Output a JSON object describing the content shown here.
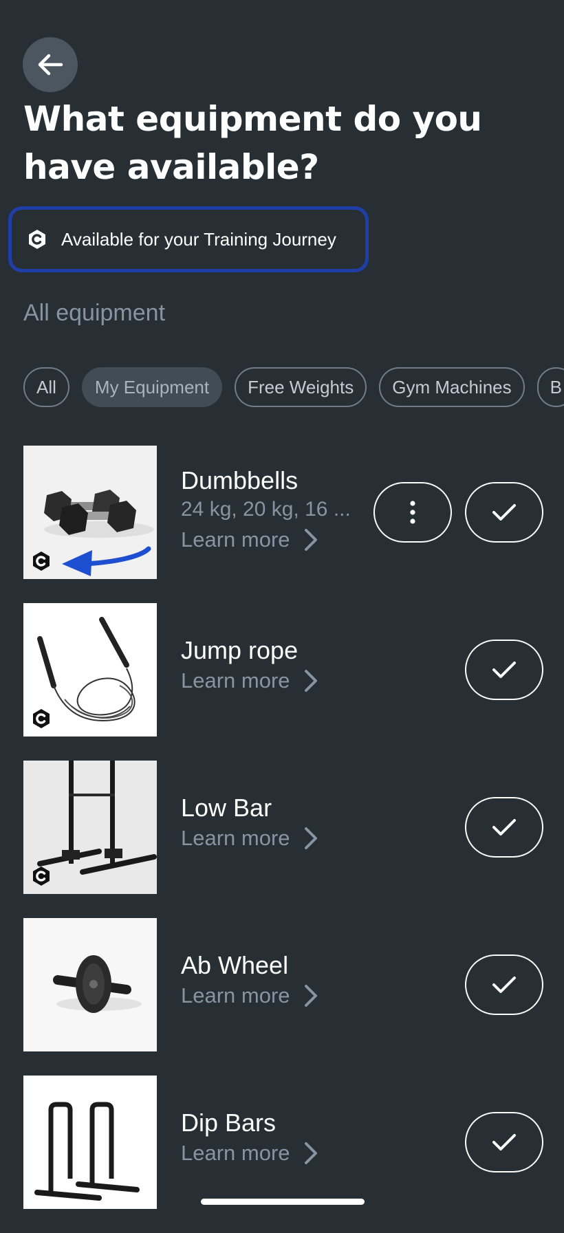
{
  "header": {
    "back_icon": "arrow-left-icon",
    "title": "What equipment do you have available?"
  },
  "journey_badge": {
    "icon": "c-logo-icon",
    "label": "Available for your Training Journey",
    "border_color": "#1f3ea8"
  },
  "section_title": "All equipment",
  "filters": [
    {
      "label": "All",
      "active": false
    },
    {
      "label": "My Equipment",
      "active": true
    },
    {
      "label": "Free Weights",
      "active": false
    },
    {
      "label": "Gym Machines",
      "active": false
    },
    {
      "label": "B",
      "active": false
    }
  ],
  "items": [
    {
      "name": "Dumbbells",
      "detail": "24 kg, 20 kg, 16 ...",
      "learn_more": "Learn more",
      "journey": true,
      "has_more": true,
      "selected": true
    },
    {
      "name": "Jump rope",
      "learn_more": "Learn more",
      "journey": true,
      "selected": true
    },
    {
      "name": "Low Bar",
      "learn_more": "Learn more",
      "journey": true,
      "selected": true
    },
    {
      "name": "Ab Wheel",
      "learn_more": "Learn more",
      "journey": false,
      "selected": true
    },
    {
      "name": "Dip Bars",
      "learn_more": "Learn more",
      "journey": false,
      "selected": true
    }
  ],
  "colors": {
    "background": "#272e34",
    "muted_text": "#8795a2",
    "annotation_arrow": "#1f4fd1"
  }
}
